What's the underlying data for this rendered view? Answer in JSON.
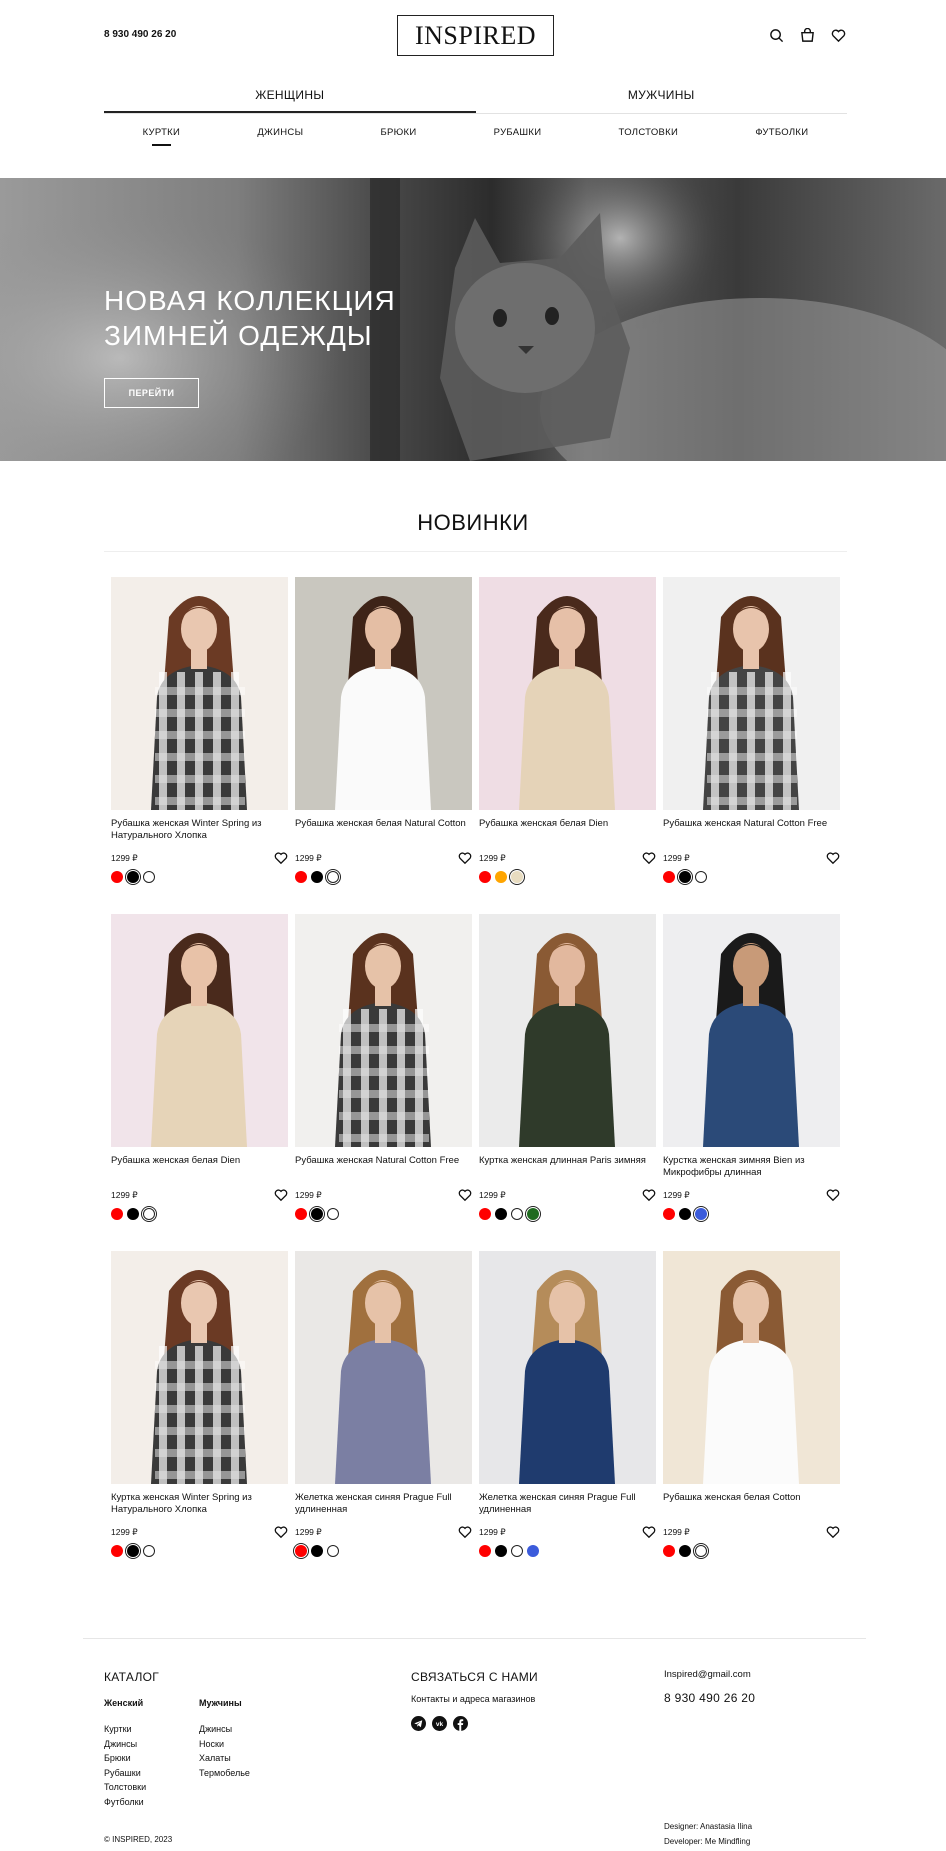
{
  "header": {
    "phone": "8 930 490 26 20",
    "logo": "INSPIRED",
    "icons": [
      "search-icon",
      "bag-icon",
      "heart-icon"
    ]
  },
  "gender_tabs": [
    {
      "label": "ЖЕНЩИНЫ",
      "active": true
    },
    {
      "label": "МУЖЧИНЫ",
      "active": false
    }
  ],
  "categories": [
    {
      "label": "КУРТКИ",
      "active": true
    },
    {
      "label": "ДЖИНСЫ",
      "active": false
    },
    {
      "label": "БРЮКИ",
      "active": false
    },
    {
      "label": "РУБАШКИ",
      "active": false
    },
    {
      "label": "ТОЛСТОВКИ",
      "active": false
    },
    {
      "label": "ФУТБОЛКИ",
      "active": false
    }
  ],
  "hero": {
    "title_line1": "НОВАЯ КОЛЛЕКЦИЯ",
    "title_line2": "ЗИМНЕЙ ОДЕЖДЫ",
    "button": "ПЕРЕЙТИ"
  },
  "section_title": "НОВИНКИ",
  "colors": {
    "red": "#ff0000",
    "black": "#000000",
    "white": "#ffffff",
    "orange": "#ffa500",
    "beige": "#e8dcc0",
    "green": "#1f6b1f",
    "blue": "#3b5bdb"
  },
  "products": [
    {
      "name": "Рубашка женская Winter Spring из Натурального Хлопка",
      "price": "1299 ₽",
      "colors": [
        "red",
        "black",
        "white"
      ],
      "selected": 1,
      "bg": "#f3eee9",
      "garment": "#3a3a3a",
      "plaid": true,
      "skin": "#e9c7b0",
      "hair": "#6b3a24"
    },
    {
      "name": "Рубашка женская белая Natural Cotton",
      "price": "1299 ₽",
      "colors": [
        "red",
        "black",
        "white"
      ],
      "selected": 2,
      "bg": "#c9c7bf",
      "garment": "#fafafa",
      "plaid": false,
      "skin": "#e4bea4",
      "hair": "#3e2418"
    },
    {
      "name": "Рубашка женская белая Dien",
      "price": "1299 ₽",
      "colors": [
        "red",
        "orange",
        "beige"
      ],
      "selected": 2,
      "bg": "#efdde4",
      "garment": "#e5d3b8",
      "plaid": false,
      "skin": "#e6c0a8",
      "hair": "#4a2a1c"
    },
    {
      "name": "Рубашка женская Natural Cotton Free",
      "price": "1299 ₽",
      "colors": [
        "red",
        "black",
        "white"
      ],
      "selected": 1,
      "bg": "#f0f0f0",
      "garment": "#444444",
      "plaid": true,
      "skin": "#e8c4ac",
      "hair": "#5a321e"
    },
    {
      "name": "Рубашка женская белая Dien",
      "price": "1299 ₽",
      "colors": [
        "red",
        "black",
        "white"
      ],
      "selected": 2,
      "bg": "#f1e4ea",
      "garment": "#e6d4b8",
      "plaid": false,
      "skin": "#e8c2a8",
      "hair": "#4a2a1c"
    },
    {
      "name": "Рубашка женская Natural Cotton Free",
      "price": "1299 ₽",
      "colors": [
        "red",
        "black",
        "white"
      ],
      "selected": 1,
      "bg": "#f1f0ee",
      "garment": "#3a3a3a",
      "plaid": true,
      "skin": "#e6c2a8",
      "hair": "#5a321e"
    },
    {
      "name": "Куртка женская длинная Paris зимняя",
      "price": "1299 ₽",
      "colors": [
        "red",
        "black",
        "white",
        "green"
      ],
      "selected": 3,
      "bg": "#ebebeb",
      "garment": "#2f3a2a",
      "plaid": false,
      "skin": "#e2b89e",
      "hair": "#8a5a34"
    },
    {
      "name": "Курстка женская зимняя Bien из Микрофибры длинная",
      "price": "1299 ₽",
      "colors": [
        "red",
        "black",
        "blue"
      ],
      "selected": 2,
      "bg": "#eeeef0",
      "garment": "#2b4a78",
      "plaid": false,
      "skin": "#c89a78",
      "hair": "#1a1a1a"
    },
    {
      "name": "Куртка женская Winter Spring из Натурального Хлопка",
      "price": "1299 ₽",
      "colors": [
        "red",
        "black",
        "white"
      ],
      "selected": 1,
      "bg": "#f3eee9",
      "garment": "#3a3a3a",
      "plaid": true,
      "skin": "#e9c7b0",
      "hair": "#6b3a24"
    },
    {
      "name": "Желетка женская синяя Prague Full удлиненная",
      "price": "1299 ₽",
      "colors": [
        "red",
        "black",
        "white"
      ],
      "selected": 0,
      "bg": "#eae8e6",
      "garment": "#7b7fa3",
      "plaid": false,
      "skin": "#e6c2a8",
      "hair": "#a0703e"
    },
    {
      "name": "Желетка женская синяя Prague Full удлиненная",
      "price": "1299 ₽",
      "colors": [
        "red",
        "black",
        "white",
        "blue"
      ],
      "selected": -1,
      "bg": "#e7e7e9",
      "garment": "#1f3b6e",
      "plaid": false,
      "skin": "#e6c2a8",
      "hair": "#b58c5a"
    },
    {
      "name": "Рубашка женская белая Cotton",
      "price": "1299 ₽",
      "colors": [
        "red",
        "black",
        "white"
      ],
      "selected": 2,
      "bg": "#f0e6d6",
      "garment": "#fbfbfb",
      "plaid": false,
      "skin": "#e6c2a8",
      "hair": "#8a5a34"
    }
  ],
  "footer": {
    "catalog_title": "КАТАЛОГ",
    "women_title": "Женский",
    "women_items": [
      "Куртки",
      "Джинсы",
      "Брюки",
      "Рубашки",
      "Толстовки",
      "Футболки"
    ],
    "men_title": "Мужчины",
    "men_items": [
      "Джинсы",
      "Носки",
      "Халаты",
      "Термобелье"
    ],
    "contact_title": "СВЯЗАТЬСЯ С НАМИ",
    "contact_link": "Контакты и адреса магазинов",
    "socials": [
      "telegram-icon",
      "vk-icon",
      "facebook-icon"
    ],
    "email": "Inspired@gmail.com",
    "phone": "8 930 490 26 20",
    "copyright": "© INSPIRED, 2023",
    "designer": "Designer: Anastasia Ilina",
    "developer": "Developer: Me Mindfling"
  }
}
